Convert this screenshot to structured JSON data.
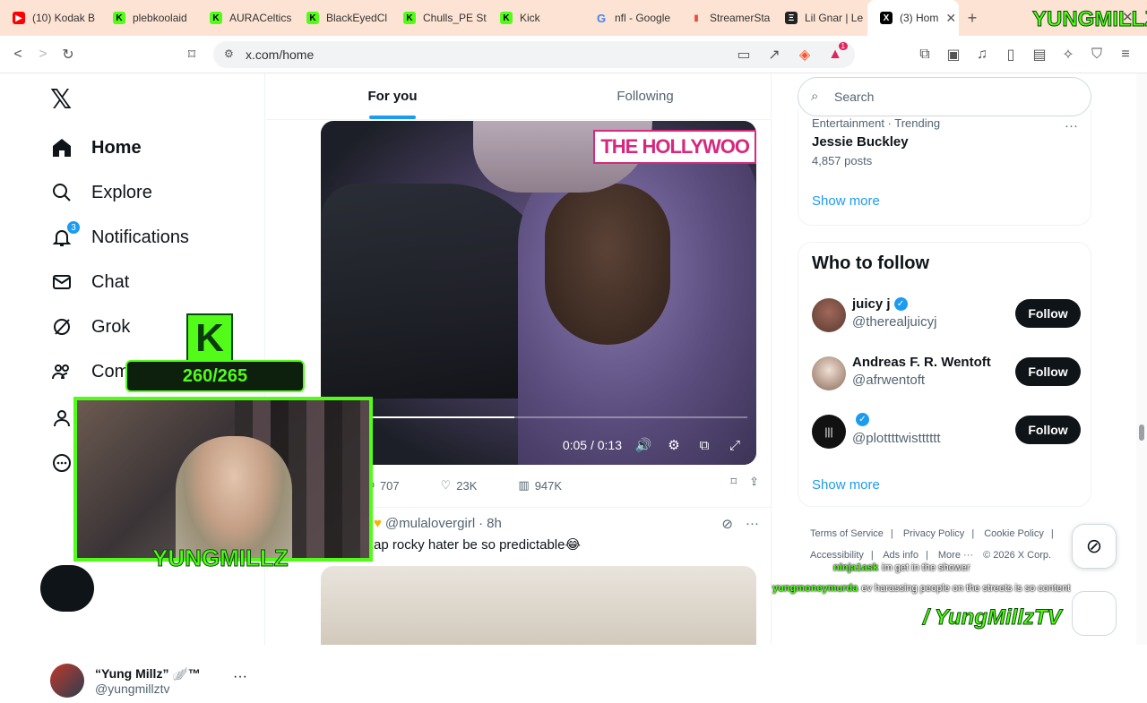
{
  "browser": {
    "tabs": [
      {
        "label": "(10) Kodak B",
        "icon": "youtube-icon",
        "color": "#ff0000"
      },
      {
        "label": "plebkoolaid",
        "icon": "kick-icon",
        "color": "#53fc18"
      },
      {
        "label": "AURACeltics",
        "icon": "kick-icon",
        "color": "#53fc18"
      },
      {
        "label": "BlackEyedCl",
        "icon": "kick-icon",
        "color": "#53fc18"
      },
      {
        "label": "Chulls_PE St",
        "icon": "kick-icon",
        "color": "#53fc18"
      },
      {
        "label": "Kick",
        "icon": "kick-icon",
        "color": "#53fc18"
      },
      {
        "label": "nfl - Google",
        "icon": "google-icon",
        "color": "#4285f4"
      },
      {
        "label": "StreamerSta",
        "icon": "chart-icon",
        "color": "#e74c3c"
      },
      {
        "label": "Lil Gnar | Le",
        "icon": "genius-icon",
        "color": "#222222"
      },
      {
        "label": "(3) Hom",
        "icon": "x-icon",
        "color": "#000000"
      }
    ],
    "url": "x.com/home",
    "brave_badge": "1"
  },
  "sidebar": {
    "logo": "𝕏",
    "items": [
      {
        "label": "Home",
        "icon": "home-icon"
      },
      {
        "label": "Explore",
        "icon": "search-icon"
      },
      {
        "label": "Notifications",
        "icon": "bell-icon",
        "badge": "3"
      },
      {
        "label": "Chat",
        "icon": "mail-icon"
      },
      {
        "label": "Grok",
        "icon": "grok-icon"
      },
      {
        "label": "Com",
        "icon": "communities-icon"
      }
    ],
    "account": {
      "name": "“Yung Millz” 🪽™",
      "handle": "@yungmillztv"
    }
  },
  "feed": {
    "tabs": [
      "For you",
      "Following"
    ],
    "video": {
      "overlay_text": "THE HOLLYWOO",
      "time": "0:05 / 0:13",
      "progress_fraction": 0.38
    },
    "actions": {
      "retweets": "707",
      "likes": "23K",
      "views": "947K"
    },
    "tweet2": {
      "handle": "@mulalovergirl",
      "time": "8h",
      "text": "ap rocky hater be so predictable😂"
    }
  },
  "right": {
    "search_placeholder": "Search",
    "trend": {
      "meta": "Entertainment · Trending",
      "name": "Jessie Buckley",
      "posts": "4,857 posts"
    },
    "show_more": "Show more",
    "who_to_follow": {
      "title": "Who to follow",
      "users": [
        {
          "name": "juicy j",
          "handle": "@therealjuicyj",
          "verified": true,
          "avatar_color": "#7a4a3a"
        },
        {
          "name": "Andreas F. R. Wentoft",
          "handle": "@afrwentoft",
          "verified": false,
          "avatar_color": "#d8c3b5"
        },
        {
          "name": "",
          "handle": "@plottttwistttttt",
          "verified": true,
          "avatar_color": "#111111"
        }
      ],
      "follow_label": "Follow"
    },
    "footer": [
      "Terms of Service",
      "|",
      "Privacy Policy",
      "|",
      "Cookie Policy",
      "|",
      "Accessibility",
      "|",
      "Ads info",
      "|",
      "More ···",
      "© 2026 X Corp."
    ]
  },
  "stream_overlay": {
    "k_letter": "K",
    "count": "260/265",
    "streamer": "YUNGMILLZ",
    "brand": "YUNGMILLZ",
    "chat": [
      {
        "user": "ninja1ask",
        "msg": "im get in the shower"
      },
      {
        "user": "yungmoneymurda",
        "msg": "ev harassing people on the streets is so content"
      }
    ],
    "socials": "/ YungMillzTV"
  }
}
